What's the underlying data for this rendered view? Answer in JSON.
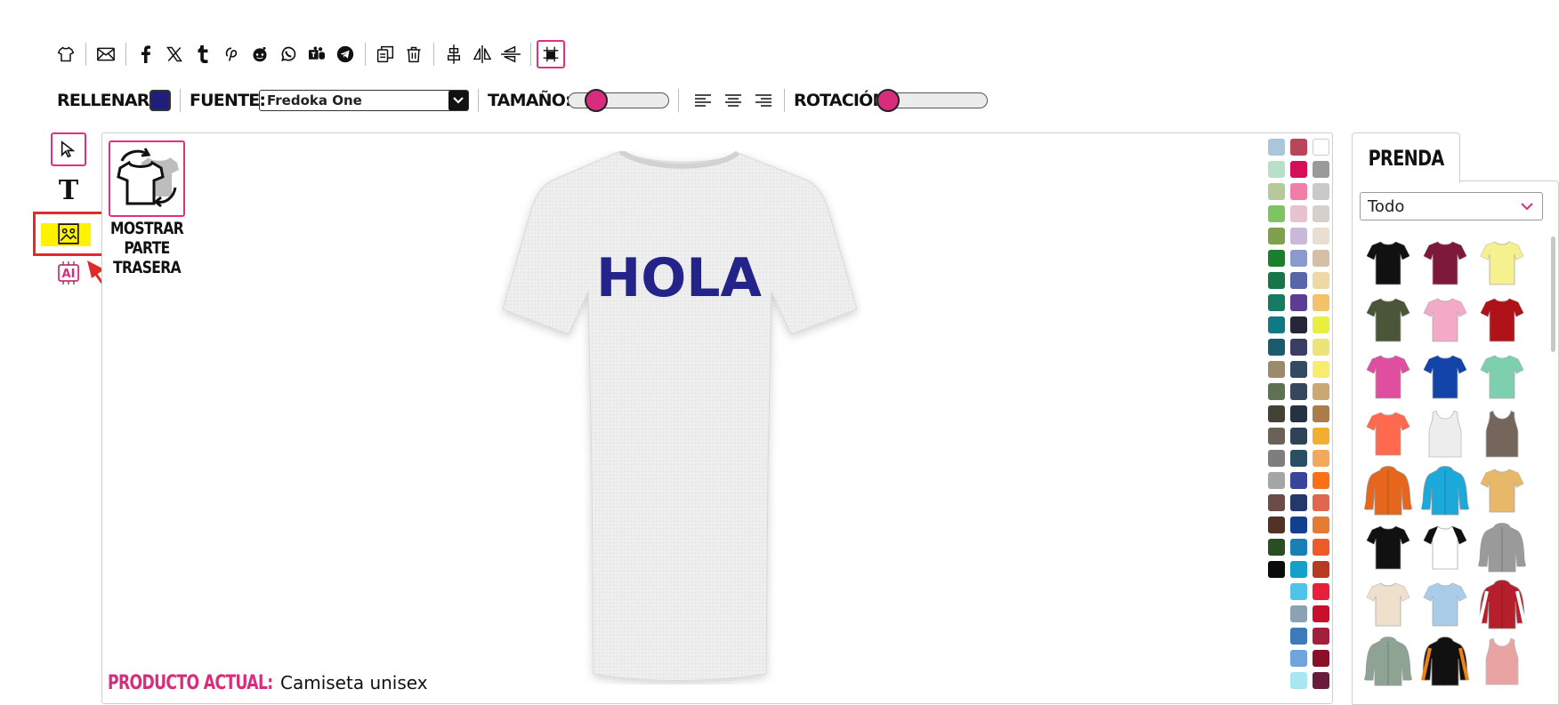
{
  "toolbar": {
    "icons": [
      "shirt-icon",
      "email-icon",
      "facebook-icon",
      "x-icon",
      "tumblr-icon",
      "pinterest-icon",
      "reddit-icon",
      "whatsapp-icon",
      "teams-icon",
      "telegram-icon",
      "copy-icon",
      "trash-icon",
      "align-center-icon",
      "flip-horizontal-icon",
      "flip-vertical-icon",
      "grid-icon"
    ]
  },
  "props": {
    "fill_label": "RELLENAR:",
    "fill_color": "#1f1f7a",
    "font_label": "FUENTE:",
    "font_value": "Fredoka One",
    "size_label": "TAMAÑO:",
    "size_level": 0.2,
    "rotation_label": "ROTACIÓN:",
    "rotation_level": 0.08
  },
  "tools": {
    "items": [
      "select-tool",
      "text-tool",
      "image-tool",
      "ai-tool"
    ],
    "active": "image-tool"
  },
  "show_back": {
    "label_line1": "MOSTRAR",
    "label_line2": "PARTE",
    "label_line3": "TRASERA"
  },
  "design": {
    "text": "HOLA",
    "text_color": "#23238a",
    "shirt_color": "#ececec"
  },
  "current_product": {
    "label": "PRODUCTO ACTUAL:",
    "value": "Camiseta unisex"
  },
  "palette": {
    "col1": [
      "#a9c6dc",
      "#b6e0c7",
      "#b7c89b",
      "#7ec460",
      "#7fa04f",
      "#1a7f2d",
      "#16764a",
      "#177b63",
      "#107a84",
      "#1a5b6c",
      "#9b8a6d",
      "#5f7055",
      "#424335",
      "#6a6257",
      "#7e7e7e",
      "#a5a5a5",
      "#6b4c46",
      "#513226",
      "#2a4e22",
      "#0b0b0b"
    ],
    "col2": [
      "#b8455a",
      "#d80d5a",
      "#f07fa7",
      "#e7c3d2",
      "#c9b8d7",
      "#8a9acc",
      "#5765a9",
      "#5b3e93",
      "#26263a",
      "#3b3d63",
      "#344a63",
      "#36465d",
      "#243244",
      "#2f4357",
      "#2b4f62",
      "#39459a",
      "#25386b",
      "#133f8f",
      "#1b7fb5",
      "#14a0c8",
      "#4fc3ea",
      "#8ca1b3",
      "#3d7ab9",
      "#6ea5da",
      "#a7e6f2"
    ],
    "col3": [
      "#ffffff",
      "#9a9a9a",
      "#c9c9c9",
      "#d5d0cc",
      "#e8dfd2",
      "#d6bfa7",
      "#f0d8a6",
      "#f3c36a",
      "#e8ef3e",
      "#ece478",
      "#f8ec70",
      "#c9a873",
      "#ab7c48",
      "#f2ae2f",
      "#f4a85c",
      "#f97016",
      "#e0664d",
      "#e57c34",
      "#ef5b28",
      "#b63b1f",
      "#e81f3a",
      "#c8102e",
      "#a3203c",
      "#8b1027",
      "#6a1c3c"
    ]
  },
  "prenda": {
    "tab_label": "PRENDA",
    "filter_value": "Todo",
    "garments": [
      "black-tshirt",
      "maroon-tshirt",
      "yellow-tshirt",
      "olive-tshirt",
      "pink-tshirt",
      "red-tshirt",
      "magenta-tshirt",
      "blue-tshirt",
      "mint-tshirt",
      "coral-tshirt",
      "white-tanktop",
      "brown-tanktop",
      "orange-hoodie",
      "cyan-hoodie",
      "tiedye-tshirt",
      "navy-tshirt",
      "raglan-tshirt",
      "grey-hoodie",
      "cream-tshirt",
      "gradient-tshirt",
      "red-varsity-jacket",
      "sage-sweatshirt",
      "black-orange-hoodie",
      "rose-tanktop"
    ],
    "colors": [
      "#111111",
      "#7d1a3b",
      "#f7f08e",
      "#4b5638",
      "#f2aac6",
      "#b0121a",
      "#e04f9f",
      "#1345a8",
      "#7ecfae",
      "#ff6a4f",
      "#ededed",
      "#74665a",
      "#e5661c",
      "#1aa9d8",
      "#e7b86a",
      "#111111",
      "#ffffff",
      "#9a9a9a",
      "#efe0cd",
      "#a9cde8",
      "#b51f2c",
      "#8ea394",
      "#111111",
      "#e9a3a3"
    ]
  }
}
